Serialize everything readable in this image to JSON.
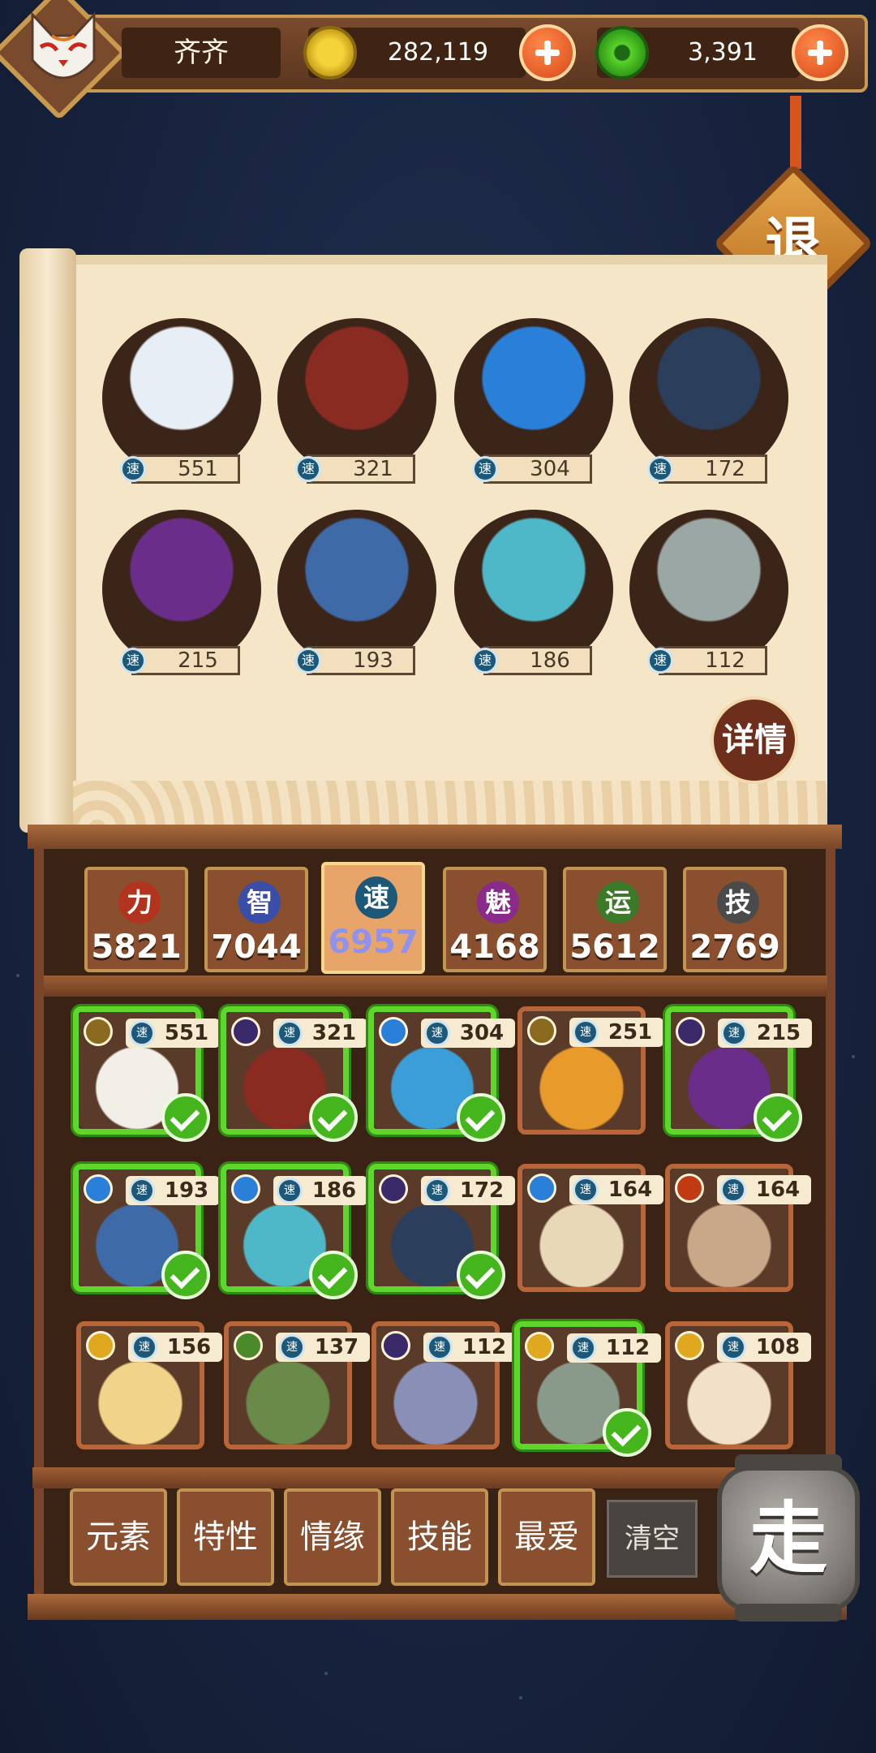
{
  "player": {
    "name": "齐齐"
  },
  "resources": {
    "gold": "282,119",
    "jade": "3,391"
  },
  "colors": {
    "selected_border": "#5fd62a",
    "speed_icon": "#1e5878",
    "accent_plus": "#d7481a"
  },
  "exit_label": "退",
  "detail_label": "详情",
  "team": [
    {
      "speed_label": "速",
      "value": "551",
      "icon": "fox-spirit-icon",
      "color": "#e8eef5"
    },
    {
      "speed_label": "速",
      "value": "321",
      "icon": "opera-general-icon",
      "color": "#8a2b22"
    },
    {
      "speed_label": "速",
      "value": "304",
      "icon": "wave-rider-icon",
      "color": "#2a7fd8"
    },
    {
      "speed_label": "速",
      "value": "172",
      "icon": "dark-mask-beast-icon",
      "color": "#2b3e5c"
    },
    {
      "speed_label": "速",
      "value": "215",
      "icon": "purple-sorceress-icon",
      "color": "#6a2e8a"
    },
    {
      "speed_label": "速",
      "value": "193",
      "icon": "blue-flame-ape-icon",
      "color": "#3f6aa8"
    },
    {
      "speed_label": "速",
      "value": "186",
      "icon": "twin-mermaid-icon",
      "color": "#4fb8c8"
    },
    {
      "speed_label": "速",
      "value": "112",
      "icon": "chef-robot-icon",
      "color": "#9aa7a4"
    }
  ],
  "attributes": [
    {
      "label": "力",
      "value": "5821",
      "color": "#b3341e",
      "selected": false
    },
    {
      "label": "智",
      "value": "7044",
      "color": "#3a4ea8",
      "selected": false
    },
    {
      "label": "速",
      "value": "6957",
      "color": "#1e5878",
      "selected": true
    },
    {
      "label": "魅",
      "value": "4168",
      "color": "#8a2a8a",
      "selected": false
    },
    {
      "label": "运",
      "value": "5612",
      "color": "#3c7a2a",
      "selected": false
    },
    {
      "label": "技",
      "value": "2769",
      "color": "#4a4a4a",
      "selected": false
    }
  ],
  "pets": [
    {
      "speed_label": "速",
      "value": "551",
      "element": "earth-element-icon",
      "element_color": "#8a6a1e",
      "art_color": "#f2efe8",
      "selected": true
    },
    {
      "speed_label": "速",
      "value": "321",
      "element": "moon-element-icon",
      "element_color": "#3a2a6a",
      "art_color": "#8a2b22",
      "selected": true
    },
    {
      "speed_label": "速",
      "value": "304",
      "element": "water-element-icon",
      "element_color": "#2a7fd8",
      "art_color": "#3b9ed8",
      "selected": true
    },
    {
      "speed_label": "速",
      "value": "251",
      "element": "earth-element-icon",
      "element_color": "#8a6a1e",
      "art_color": "#e89a2a",
      "selected": false
    },
    {
      "speed_label": "速",
      "value": "215",
      "element": "moon-element-icon",
      "element_color": "#3a2a6a",
      "art_color": "#6a2e8a",
      "selected": true
    },
    {
      "speed_label": "速",
      "value": "193",
      "element": "water-element-icon",
      "element_color": "#2a7fd8",
      "art_color": "#3f6aa8",
      "selected": true
    },
    {
      "speed_label": "速",
      "value": "186",
      "element": "water-element-icon",
      "element_color": "#2a7fd8",
      "art_color": "#4fb8c8",
      "selected": true
    },
    {
      "speed_label": "速",
      "value": "172",
      "element": "moon-element-icon",
      "element_color": "#3a2a6a",
      "art_color": "#2b3e5c",
      "selected": true
    },
    {
      "speed_label": "速",
      "value": "164",
      "element": "water-element-icon",
      "element_color": "#2a7fd8",
      "art_color": "#e8d8b8",
      "selected": false
    },
    {
      "speed_label": "速",
      "value": "164",
      "element": "fire-element-icon",
      "element_color": "#c23a14",
      "art_color": "#c9a88a",
      "selected": false
    },
    {
      "speed_label": "速",
      "value": "156",
      "element": "light-element-icon",
      "element_color": "#e0a81e",
      "art_color": "#f1d48a",
      "selected": false
    },
    {
      "speed_label": "速",
      "value": "137",
      "element": "wood-element-icon",
      "element_color": "#4a8a2a",
      "art_color": "#6a8a4a",
      "selected": false
    },
    {
      "speed_label": "速",
      "value": "112",
      "element": "moon-element-icon",
      "element_color": "#3a2a6a",
      "art_color": "#8a8fb8",
      "selected": false
    },
    {
      "speed_label": "速",
      "value": "112",
      "element": "light-element-icon",
      "element_color": "#e0a81e",
      "art_color": "#8a9a8a",
      "selected": true
    },
    {
      "speed_label": "速",
      "value": "108",
      "element": "light-element-icon",
      "element_color": "#e0a81e",
      "art_color": "#f2e0c8",
      "selected": false
    }
  ],
  "filters": [
    "元素",
    "特性",
    "情缘",
    "技能",
    "最爱"
  ],
  "clear_label": "清空",
  "go_label": "走"
}
